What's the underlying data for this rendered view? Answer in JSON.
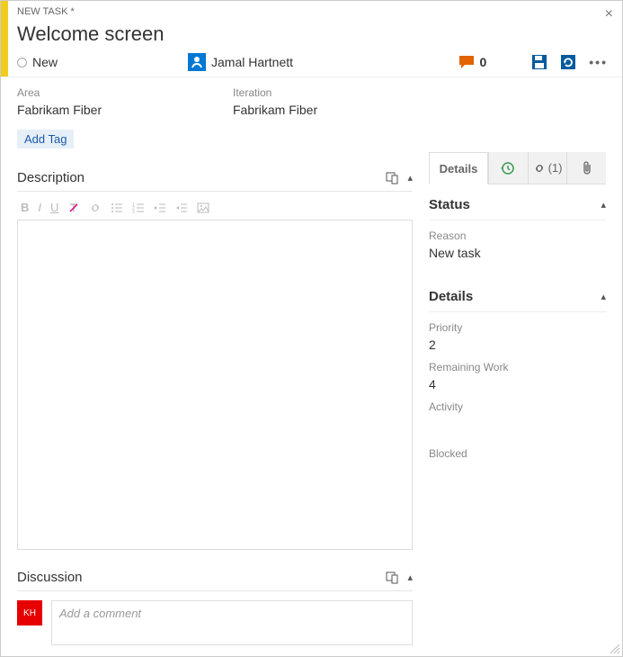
{
  "workItemType": "NEW TASK",
  "dirty": "*",
  "title": "Welcome screen",
  "state": "New",
  "assignee": "Jamal Hartnett",
  "commentsCount": "0",
  "classification": {
    "areaLabel": "Area",
    "areaValue": "Fabrikam Fiber",
    "iterationLabel": "Iteration",
    "iterationValue": "Fabrikam Fiber"
  },
  "addTagLabel": "Add Tag",
  "sections": {
    "description": "Description",
    "discussion": "Discussion"
  },
  "commentPlaceholder": "Add a comment",
  "commentAvatar": "KH",
  "tabs": {
    "details": "Details",
    "linksCount": "(1)"
  },
  "right": {
    "statusTitle": "Status",
    "reasonLabel": "Reason",
    "reasonValue": "New task",
    "detailsTitle": "Details",
    "priorityLabel": "Priority",
    "priorityValue": "2",
    "remainingWorkLabel": "Remaining Work",
    "remainingWorkValue": "4",
    "activityLabel": "Activity",
    "blockedLabel": "Blocked"
  },
  "icons": {
    "close": "×",
    "ellipsis": "•••",
    "linksGlyph": "🔗",
    "attachGlyph": "📎"
  }
}
